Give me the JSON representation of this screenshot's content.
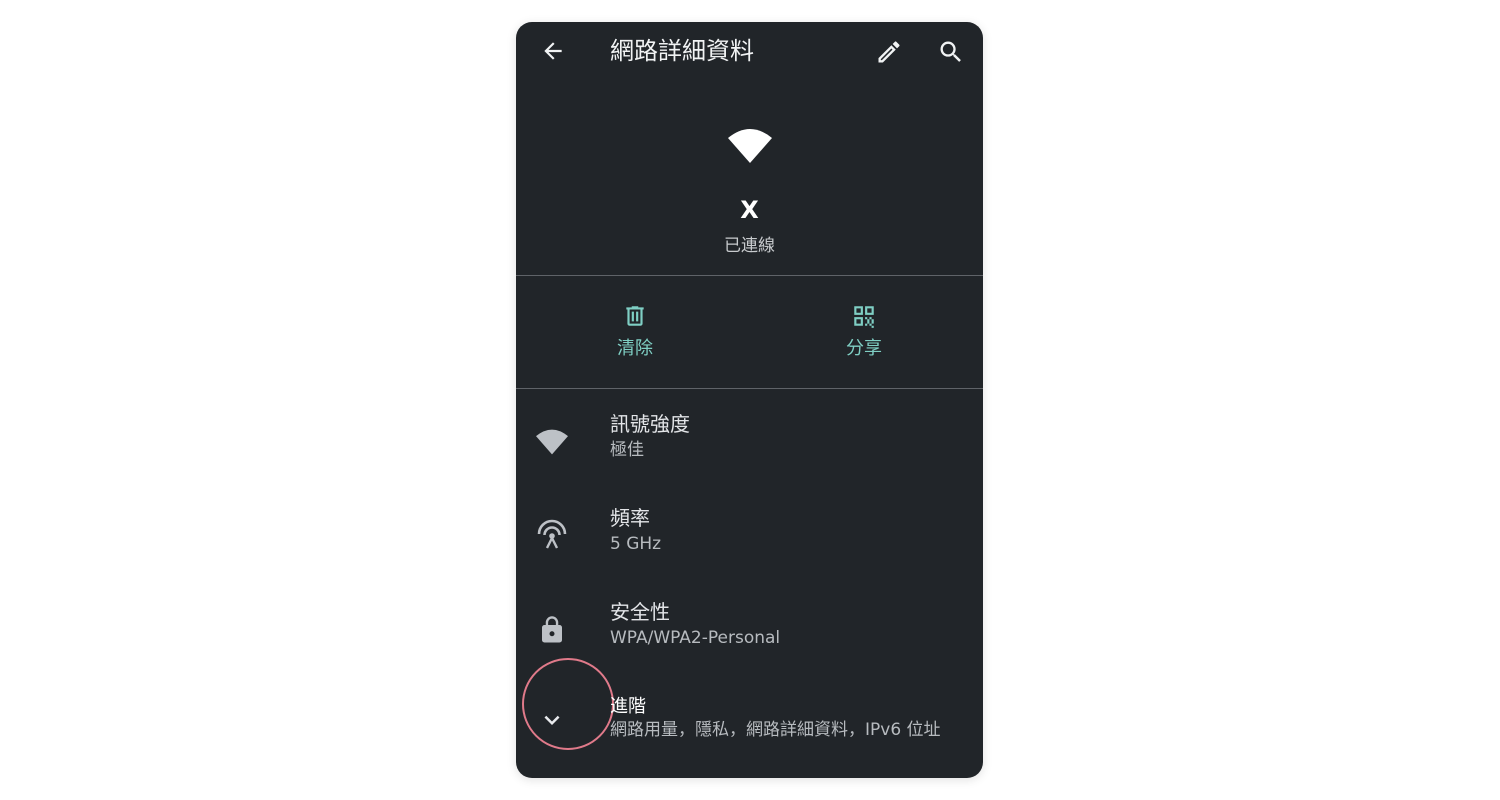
{
  "appbar": {
    "title": "網路詳細資料",
    "back_icon": "arrow-left-icon",
    "edit_icon": "pencil-icon",
    "search_icon": "search-icon"
  },
  "network": {
    "name": "X",
    "status": "已連線",
    "icon": "wifi-icon"
  },
  "actions": [
    {
      "label": "清除",
      "icon": "trash-icon"
    },
    {
      "label": "分享",
      "icon": "qr-code-icon"
    }
  ],
  "details": [
    {
      "title": "訊號強度",
      "value": "極佳",
      "icon": "wifi-signal-icon"
    },
    {
      "title": "頻率",
      "value": "5 GHz",
      "icon": "antenna-icon"
    },
    {
      "title": "安全性",
      "value": "WPA/WPA2-Personal",
      "icon": "lock-icon"
    },
    {
      "title": "進階",
      "value": "網路用量，隱私，網路詳細資料，IPv6 位址",
      "icon": "chevron-down-icon"
    }
  ],
  "colors": {
    "background": "#212529",
    "accent": "#7fcfc4",
    "highlight_ring": "#e07a8a"
  }
}
